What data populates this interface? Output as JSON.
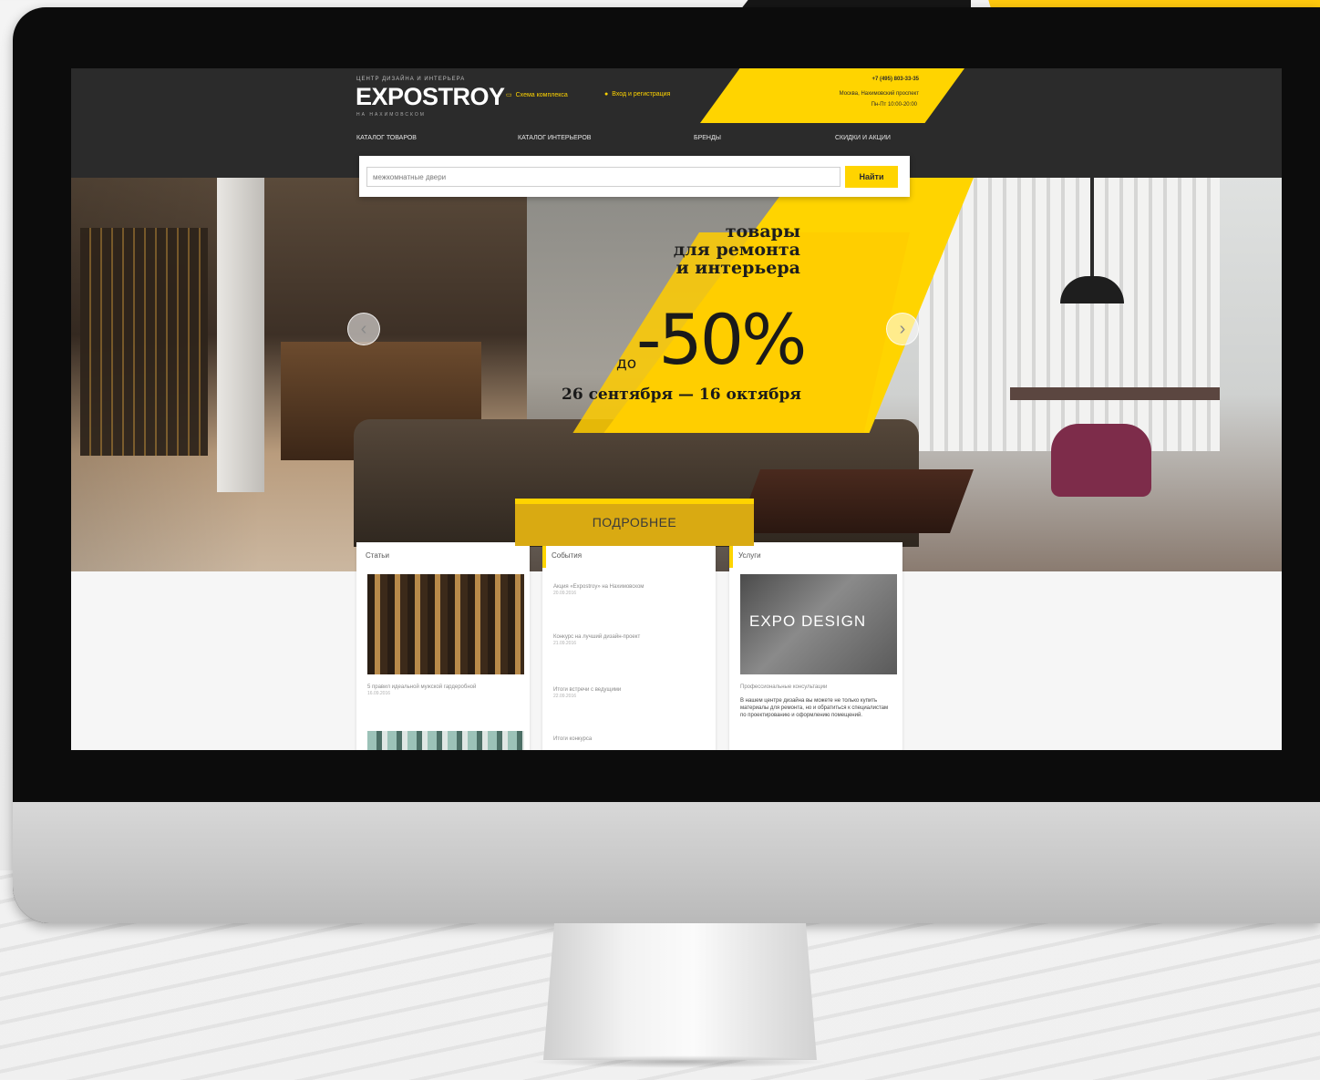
{
  "site": {
    "logo_tagline": "ЦЕНТР ДИЗАЙНА И ИНТЕРЬЕРА",
    "logo": "EXPOSTROY",
    "logo_sub": "НА НАХИМОВСКОМ",
    "header_links": [
      {
        "label": "Схема комплекса",
        "icon": "map-icon"
      },
      {
        "label": "Вход и регистрация",
        "icon": "user-icon"
      }
    ],
    "contact": {
      "phone": "+7 (495) 803-33-35",
      "address": "Москва, Нахимовский проспект",
      "hours": "Пн-Пт 10:00-20:00"
    },
    "nav": [
      "КАТАЛОГ ТОВАРОВ",
      "КАТАЛОГ ИНТЕРЬЕРОВ",
      "БРЕНДЫ",
      "СКИДКИ И АКЦИИ"
    ],
    "search": {
      "value": "межкомнатные двери",
      "button": "Найти"
    }
  },
  "hero": {
    "line1": "товары",
    "line2": "для ремонта",
    "line3": "и интерьера",
    "discount": "-50%",
    "prefix": "до",
    "dates": "26 сентября — 16 октября",
    "cta": "ПОДРОБНЕЕ",
    "prev_icon": "chevron-left-icon",
    "next_icon": "chevron-right-icon"
  },
  "cards": [
    {
      "title": "Статьи",
      "items": [
        {
          "text": "5 правил идеальной мужской гардеробной",
          "date": "16.09.2016"
        }
      ]
    },
    {
      "title": "События",
      "items": [
        {
          "text": "Акция «Expostroy» на Нахимовском",
          "date": "20.09.2016"
        },
        {
          "text": "Конкурс на лучший дизайн-проект",
          "date": "21.09.2016"
        },
        {
          "text": "Итоги встречи с ведущими",
          "date": "22.09.2016"
        },
        {
          "text": "Итоги конкурса"
        }
      ]
    },
    {
      "title": "Услуги",
      "image_text": "EXPO DESIGN",
      "items": [
        {
          "text": "Профессиональные консультации",
          "desc": "В нашем центре дизайна вы можете не только купить материалы для ремонта, но и обратиться к специалистам по проектированию и оформлению помещений."
        }
      ]
    }
  ],
  "colors": {
    "accent": "#ffd400",
    "header_bg": "#2b2b2b",
    "cta_bg": "#d9aa12"
  }
}
